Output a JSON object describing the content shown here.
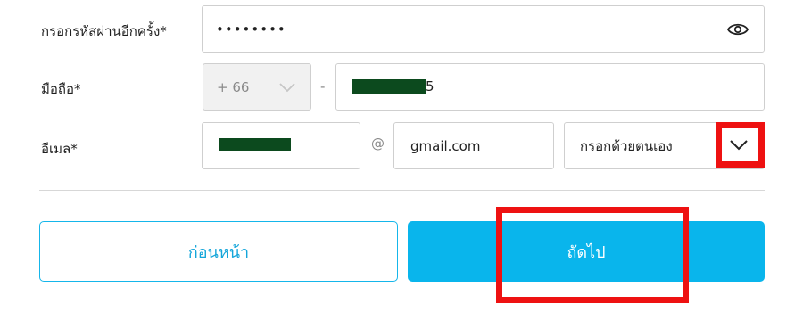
{
  "form": {
    "confirm_password": {
      "label": "กรอกรหัสผ่านอีกครั้ง*",
      "value": "••••••••",
      "icon": "eye-icon"
    },
    "mobile": {
      "label": "มือถือ*",
      "country_code": "+ 66",
      "separator": "-",
      "number_visible_suffix": "5"
    },
    "email": {
      "label": "อีเมล*",
      "at_symbol": "@",
      "domain": "gmail.com",
      "domain_mode": "กรอกด้วยตนเอง"
    }
  },
  "buttons": {
    "previous": "ก่อนหน้า",
    "next": "ถัดไป"
  },
  "colors": {
    "accent": "#09b5ec",
    "highlight": "#ee1111",
    "redaction": "#0c4a1e"
  }
}
